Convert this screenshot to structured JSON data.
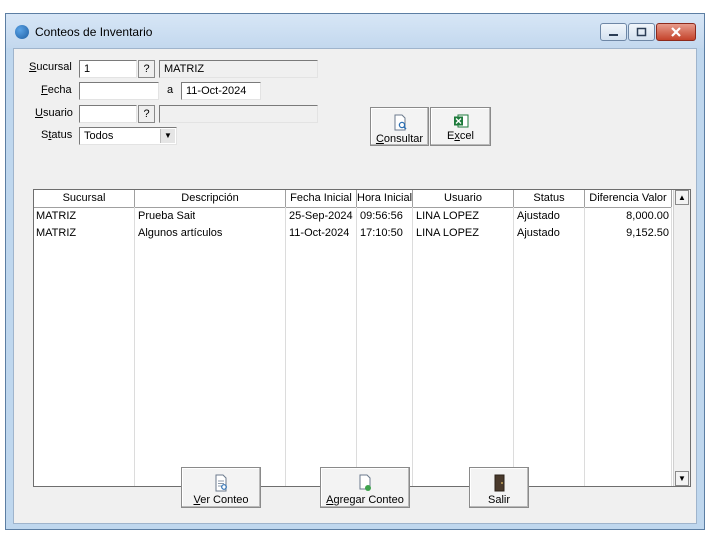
{
  "window": {
    "title": "Conteos de Inventario",
    "controls": {
      "minimize": "minimize-icon",
      "maximize": "maximize-icon",
      "close": "close-icon"
    }
  },
  "form": {
    "sucursal": {
      "label_pre": "",
      "label_ul": "S",
      "label_post": "ucursal",
      "code": "1",
      "lookup": "?",
      "name": "MATRIZ"
    },
    "fecha": {
      "label_ul": "F",
      "label_post": "echa",
      "from": "",
      "separator": "a",
      "to": "11-Oct-2024"
    },
    "usuario": {
      "label_ul": "U",
      "label_post": "suario",
      "code": "",
      "lookup": "?",
      "name": ""
    },
    "status": {
      "label_pre": "S",
      "label_ul": "t",
      "label_post": "atus",
      "value": "Todos"
    }
  },
  "actions": {
    "consultar": {
      "ul": "C",
      "rest": "onsultar",
      "icon": "document-search-icon"
    },
    "excel": {
      "pre": "E",
      "ul": "x",
      "rest": "cel",
      "icon": "excel-icon"
    }
  },
  "table": {
    "columns": [
      "Sucursal",
      "Descripción",
      "Fecha Inicial",
      "Hora Inicial",
      "Usuario",
      "Status",
      "Diferencia Valor"
    ],
    "rows": [
      {
        "sucursal": "MATRIZ",
        "descripcion": "Prueba Sait",
        "fecha": "25-Sep-2024",
        "hora": "09:56:56",
        "usuario": "LINA LOPEZ",
        "status": "Ajustado",
        "diferencia": "8,000.00"
      },
      {
        "sucursal": "MATRIZ",
        "descripcion": "Algunos artículos",
        "fecha": "11-Oct-2024",
        "hora": "17:10:50",
        "usuario": "LINA LOPEZ",
        "status": "Ajustado",
        "diferencia": "9,152.50"
      }
    ]
  },
  "footer": {
    "ver_conteo": {
      "ul": "V",
      "rest": "er Conteo",
      "icon": "view-document-icon"
    },
    "agregar_conteo": {
      "ul": "A",
      "rest": "gregar Conteo",
      "icon": "add-document-icon"
    },
    "salir": {
      "label": "Salir",
      "icon": "exit-door-icon"
    }
  }
}
